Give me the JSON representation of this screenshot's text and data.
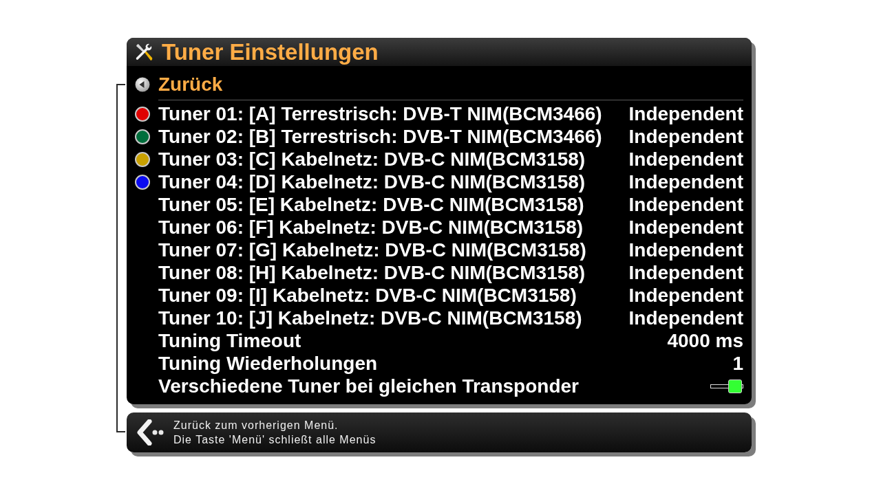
{
  "header": {
    "title": "Tuner Einstellungen"
  },
  "items": [
    {
      "kind": "back",
      "label": "Zurück",
      "selected": true
    },
    {
      "kind": "tuner",
      "label": "Tuner 01: [A] Terrestrisch: DVB-T NIM(BCM3466)",
      "value": "Independent",
      "color": "#e00000",
      "selected": false
    },
    {
      "kind": "tuner",
      "label": "Tuner 02: [B] Terrestrisch: DVB-T NIM(BCM3466)",
      "value": "Independent",
      "color": "#006e3c",
      "selected": false
    },
    {
      "kind": "tuner",
      "label": "Tuner 03: [C] Kabelnetz: DVB-C NIM(BCM3158)",
      "value": "Independent",
      "color": "#c8a000",
      "selected": false
    },
    {
      "kind": "tuner",
      "label": "Tuner 04: [D] Kabelnetz: DVB-C NIM(BCM3158)",
      "value": "Independent",
      "color": "#0a0af0",
      "selected": false
    },
    {
      "kind": "tuner",
      "label": "Tuner 05: [E] Kabelnetz: DVB-C NIM(BCM3158)",
      "value": "Independent",
      "selected": false
    },
    {
      "kind": "tuner",
      "label": "Tuner 06: [F] Kabelnetz: DVB-C NIM(BCM3158)",
      "value": "Independent",
      "selected": false
    },
    {
      "kind": "tuner",
      "label": "Tuner 07: [G] Kabelnetz: DVB-C NIM(BCM3158)",
      "value": "Independent",
      "selected": false
    },
    {
      "kind": "tuner",
      "label": "Tuner 08: [H] Kabelnetz: DVB-C NIM(BCM3158)",
      "value": "Independent",
      "selected": false
    },
    {
      "kind": "tuner",
      "label": "Tuner 09: [I] Kabelnetz: DVB-C NIM(BCM3158)",
      "value": "Independent",
      "selected": false
    },
    {
      "kind": "tuner",
      "label": "Tuner 10: [J] Kabelnetz: DVB-C NIM(BCM3158)",
      "value": "Independent",
      "selected": false
    },
    {
      "kind": "value",
      "label": "Tuning Timeout",
      "value": "4000 ms",
      "selected": false
    },
    {
      "kind": "value",
      "label": "Tuning Wiederholungen",
      "value": "1",
      "selected": false
    },
    {
      "kind": "toggle",
      "label": "Verschiedene Tuner bei gleichen Transponder",
      "on": true,
      "selected": false
    }
  ],
  "help": {
    "lines": [
      "Zurück zum vorherigen Menü.",
      "Die Taste 'Menü' schließt alle Menüs"
    ]
  }
}
